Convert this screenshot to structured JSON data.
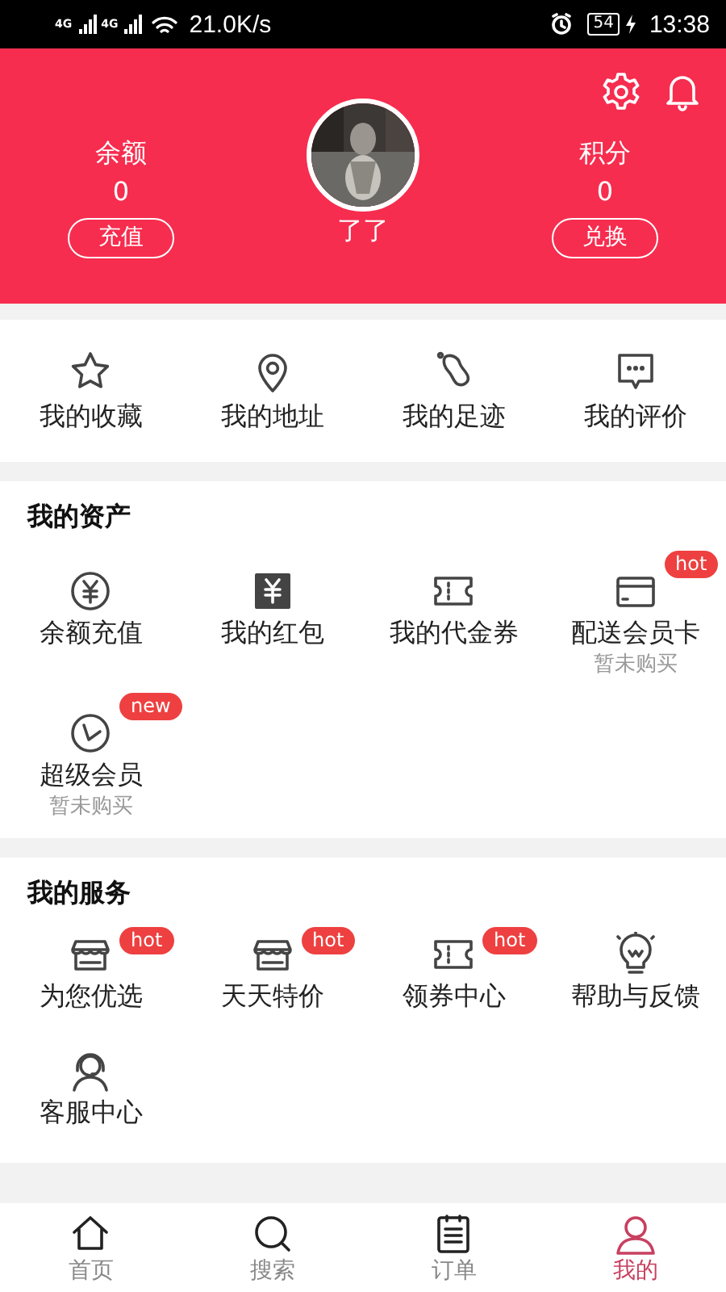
{
  "status_bar": {
    "networks": [
      "4G",
      "4G"
    ],
    "speed": "21.0K/s",
    "battery": "54",
    "time": "13:38"
  },
  "header": {
    "balance": {
      "label": "余额",
      "value": "0",
      "button": "充值"
    },
    "user": {
      "name": "了了"
    },
    "points": {
      "label": "积分",
      "value": "0",
      "button": "兑换"
    }
  },
  "quick_links": [
    {
      "label": "我的收藏"
    },
    {
      "label": "我的地址"
    },
    {
      "label": "我的足迹"
    },
    {
      "label": "我的评价"
    }
  ],
  "assets": {
    "title": "我的资产",
    "items": [
      {
        "label": "余额充值"
      },
      {
        "label": "我的红包"
      },
      {
        "label": "我的代金券"
      },
      {
        "label": "配送会员卡",
        "badge": "hot",
        "note": "暂未购买"
      },
      {
        "label": "超级会员",
        "badge": "new",
        "note": "暂未购买"
      }
    ]
  },
  "services": {
    "title": "我的服务",
    "items": [
      {
        "label": "为您优选",
        "badge": "hot"
      },
      {
        "label": "天天特价",
        "badge": "hot"
      },
      {
        "label": "领券中心",
        "badge": "hot"
      },
      {
        "label": "帮助与反馈"
      },
      {
        "label": "客服中心"
      }
    ]
  },
  "tabs": [
    {
      "label": "首页",
      "selected": false
    },
    {
      "label": "搜索",
      "selected": false
    },
    {
      "label": "订单",
      "selected": false
    },
    {
      "label": "我的",
      "selected": true
    }
  ]
}
